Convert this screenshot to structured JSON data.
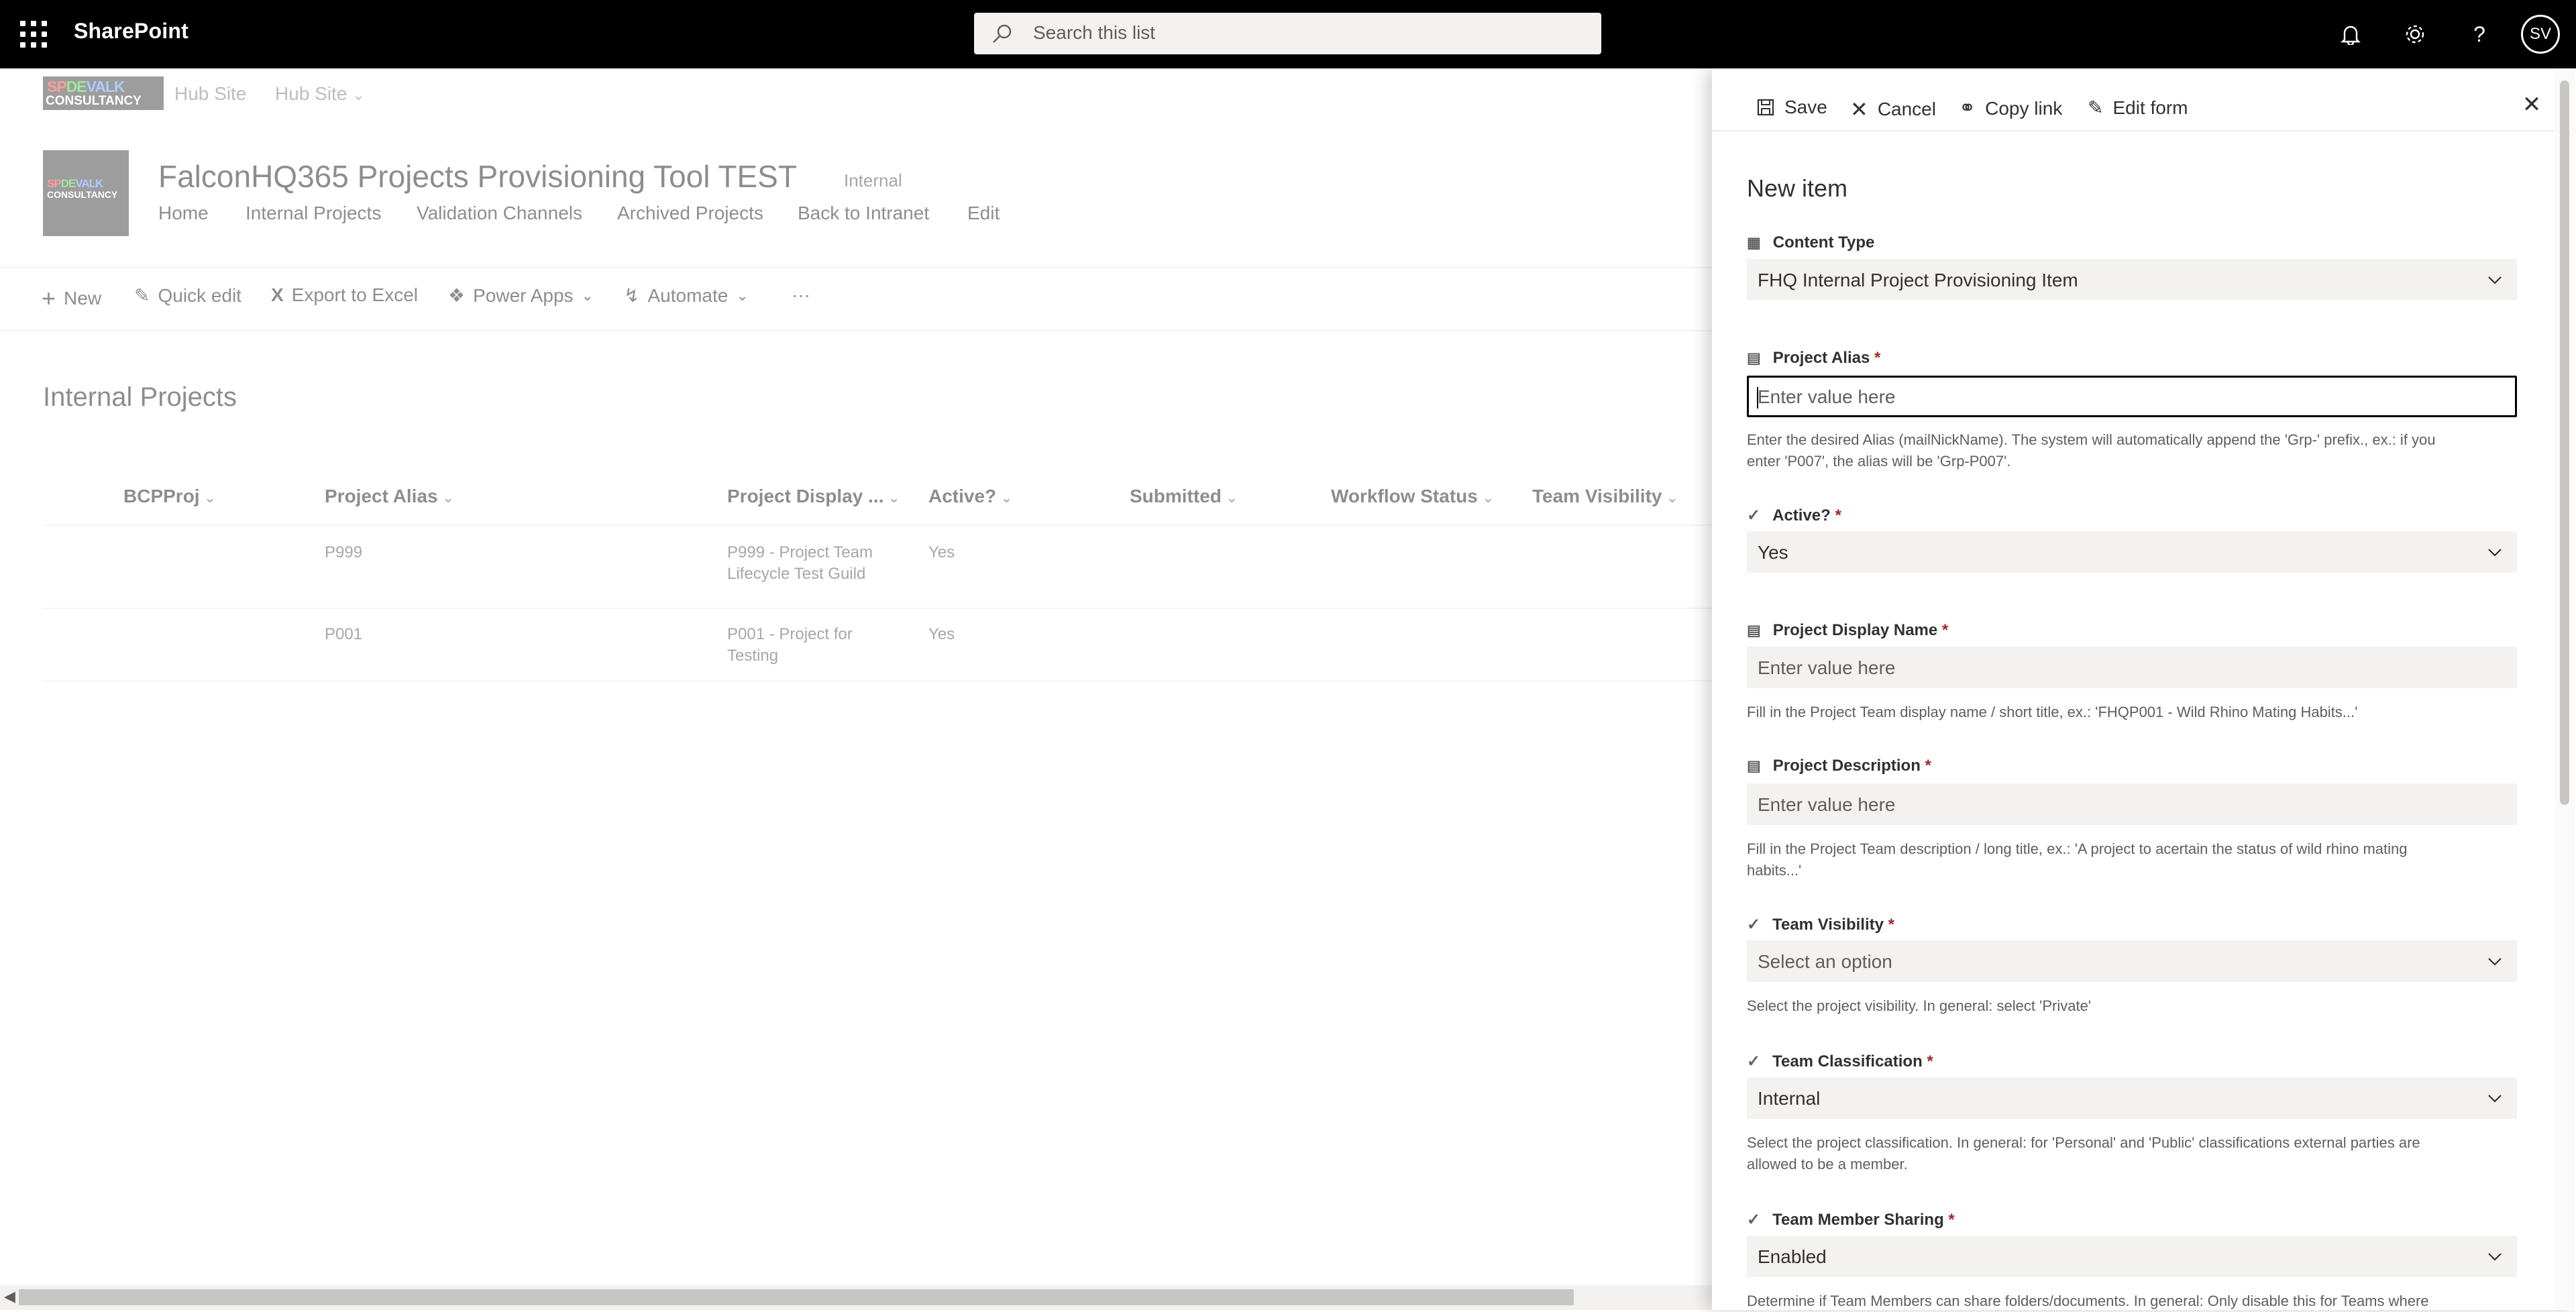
{
  "suite": {
    "app_name": "SharePoint",
    "search_placeholder": "Search this list",
    "user_initials": "SV"
  },
  "hub": {
    "logo_line1": "SPDEVALK",
    "logo_line2": "CONSULTANCY",
    "site_label": "Hub Site",
    "menu_label": "Hub Site"
  },
  "site": {
    "title": "FalconHQ365 Projects Provisioning Tool TEST",
    "badge": "Internal",
    "nav": [
      "Home",
      "Internal Projects",
      "Validation Channels",
      "Archived Projects",
      "Back to Intranet",
      "Edit"
    ]
  },
  "commands": {
    "new": "New",
    "quick_edit": "Quick edit",
    "export": "Export to Excel",
    "power_apps": "Power Apps",
    "automate": "Automate",
    "more": "···"
  },
  "list": {
    "title": "Internal Projects",
    "columns": [
      "BCPProj",
      "Project Alias",
      "Project Display ...",
      "Active?",
      "Submitted",
      "Workflow Status",
      "Team Visibility"
    ],
    "rows": [
      {
        "alias": "P999",
        "display_line1": "P999 - Project Team",
        "display_line2": "Lifecycle Test Guild",
        "active": "Yes"
      },
      {
        "alias": "P001",
        "display_line1": "P001 - Project for",
        "display_line2": "Testing",
        "active": "Yes"
      }
    ]
  },
  "panel": {
    "toolbar": {
      "save": "Save",
      "cancel": "Cancel",
      "copy_link": "Copy link",
      "edit_form": "Edit form"
    },
    "title": "New item",
    "fields": {
      "content_type": {
        "label": "Content Type",
        "value": "FHQ Internal Project Provisioning Item"
      },
      "project_alias": {
        "label": "Project Alias",
        "required": "*",
        "placeholder": "Enter value here",
        "hint_line1": "Enter the desired Alias (mailNickName). The system will automatically append the 'Grp-' prefix., ex.: if you",
        "hint_line2": "enter 'P007', the alias will be 'Grp-P007'."
      },
      "active": {
        "label": "Active?",
        "required": "*",
        "value": "Yes"
      },
      "project_display_name": {
        "label": "Project Display Name",
        "required": "*",
        "placeholder": "Enter value here",
        "hint": "Fill in the Project Team display name / short title, ex.: 'FHQP001 - Wild Rhino Mating Habits...'"
      },
      "project_description": {
        "label": "Project Description",
        "required": "*",
        "placeholder": "Enter value here",
        "hint_line1": "Fill in the Project Team description / long title, ex.: 'A project to acertain the status of wild rhino mating",
        "hint_line2": "habits...'"
      },
      "team_visibility": {
        "label": "Team Visibility",
        "required": "*",
        "placeholder": "Select an option",
        "hint": "Select the project visibility. In general: select 'Private'"
      },
      "team_classification": {
        "label": "Team Classification",
        "required": "*",
        "value": "Internal",
        "hint_line1": "Select the project classification. In general: for 'Personal' and 'Public' classifications external parties are",
        "hint_line2": "allowed to be a member."
      },
      "team_member_sharing": {
        "label": "Team Member Sharing",
        "required": "*",
        "value": "Enabled",
        "hint": "Determine if Team Members can share folders/documents. In general: Only disable this for Teams where"
      }
    }
  },
  "colors": {
    "suite_bg": "#000000",
    "accent_required": "#a4262c",
    "field_bg": "#f3f2f1"
  }
}
